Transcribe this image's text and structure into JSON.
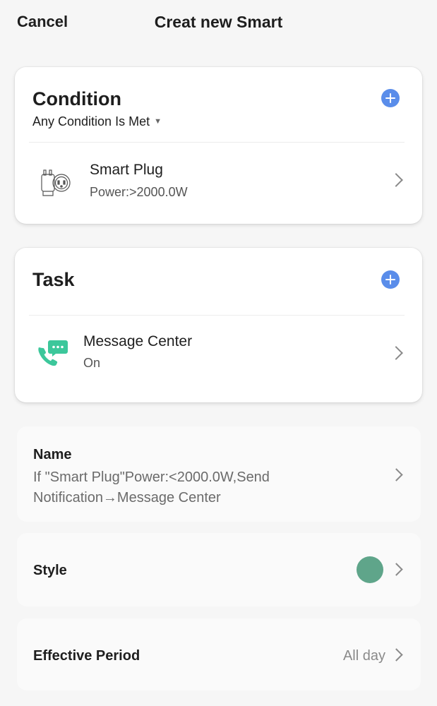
{
  "header": {
    "cancel_label": "Cancel",
    "title": "Creat new Smart"
  },
  "condition": {
    "title": "Condition",
    "mode": "Any Condition Is Met",
    "add_icon": "plus-circle-icon",
    "items": [
      {
        "name": "Smart Plug",
        "detail": "Power:>2000.0W",
        "icon": "smart-plug-icon"
      }
    ]
  },
  "task": {
    "title": "Task",
    "add_icon": "plus-circle-icon",
    "items": [
      {
        "name": "Message Center",
        "detail": "On",
        "icon": "message-phone-icon"
      }
    ]
  },
  "settings": {
    "name": {
      "label": "Name",
      "value": "If \"Smart Plug\"Power:<2000.0W,Send Notification→Message Center"
    },
    "style": {
      "label": "Style",
      "color": "#5fa58a"
    },
    "effective_period": {
      "label": "Effective Period",
      "value": "All day"
    }
  },
  "colors": {
    "accent": "#5a8dea",
    "message_icon": "#3cc79b"
  }
}
